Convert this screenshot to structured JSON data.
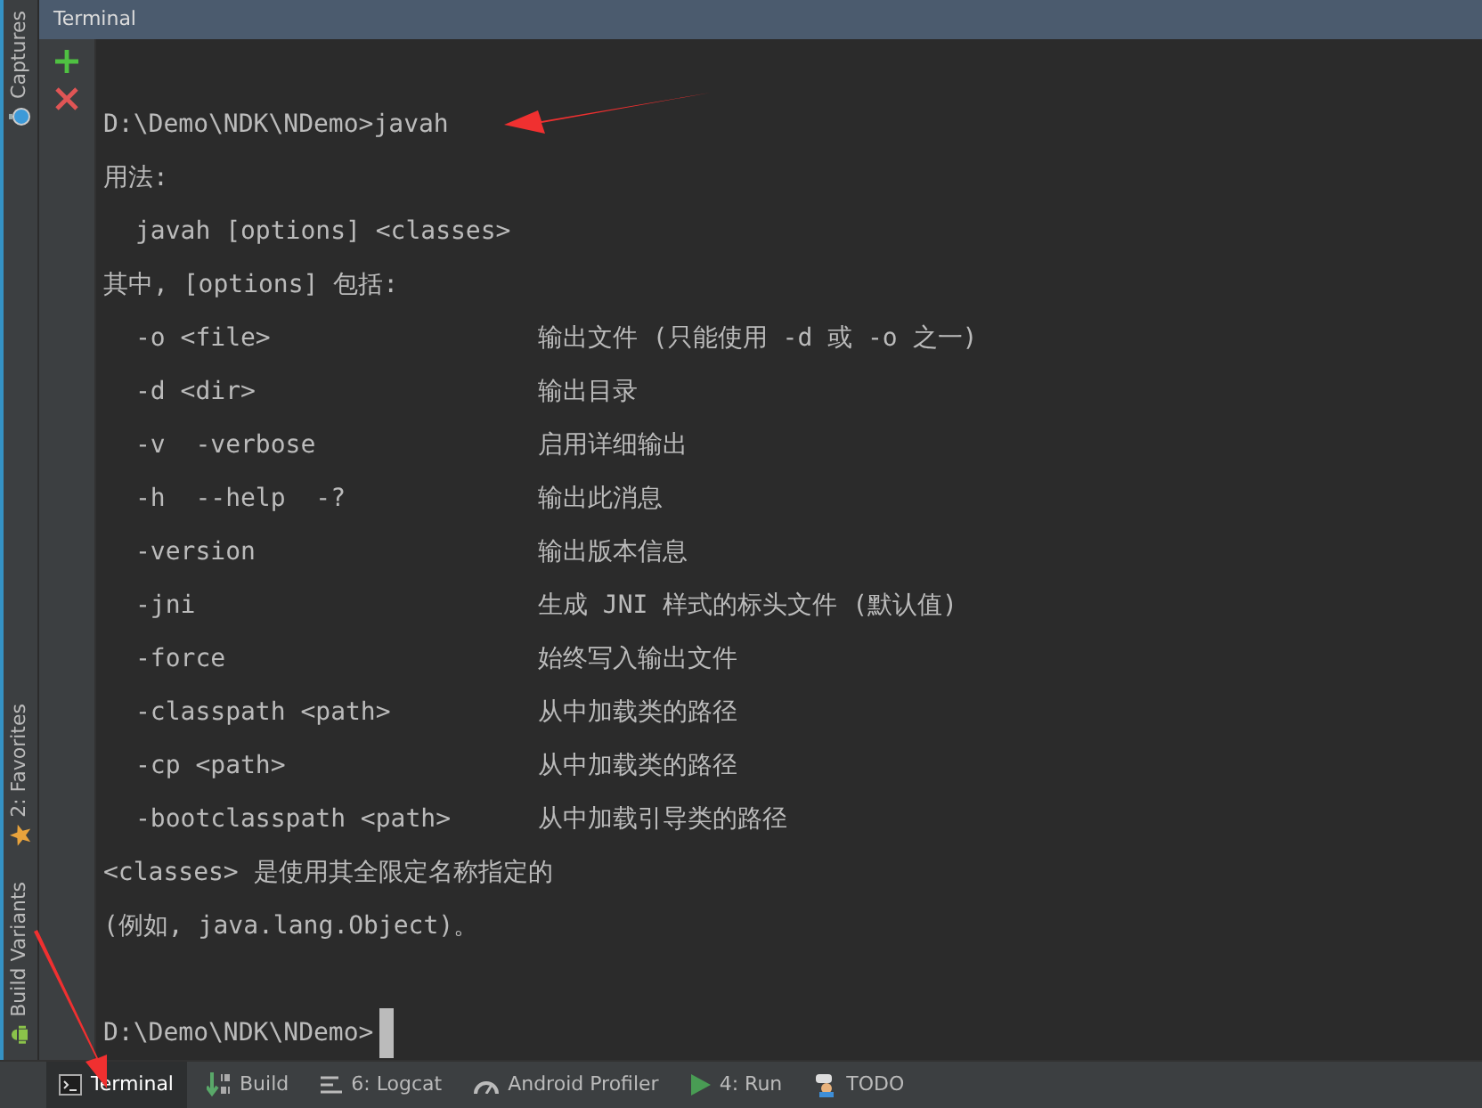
{
  "side_strip": {
    "top": [
      {
        "label": "Captures",
        "kind": "captures"
      }
    ],
    "bottom": [
      {
        "label": "2: Favorites",
        "kind": "favorites"
      },
      {
        "label": "Build Variants",
        "kind": "variants"
      }
    ]
  },
  "panel": {
    "title": "Terminal"
  },
  "terminal_lines": [
    {
      "kind": "prompt",
      "text": "D:\\Demo\\NDK\\NDemo>javah",
      "cursor": false
    },
    {
      "kind": "text",
      "text": "用法:",
      "indent": false
    },
    {
      "kind": "text",
      "text": "javah [options] <classes>",
      "indent": true
    },
    {
      "kind": "text",
      "text": "其中, [options] 包括:",
      "indent": false
    },
    {
      "kind": "option",
      "option": "-o <file>",
      "description": "输出文件 (只能使用 -d 或 -o 之一)"
    },
    {
      "kind": "option",
      "option": "-d <dir>",
      "description": "输出目录"
    },
    {
      "kind": "option",
      "option": "-v  -verbose",
      "description": "启用详细输出"
    },
    {
      "kind": "option",
      "option": "-h  --help  -?",
      "description": "输出此消息"
    },
    {
      "kind": "option",
      "option": "-version",
      "description": "输出版本信息"
    },
    {
      "kind": "option",
      "option": "-jni",
      "description": "生成 JNI 样式的标头文件 (默认值)"
    },
    {
      "kind": "option",
      "option": "-force",
      "description": "始终写入输出文件"
    },
    {
      "kind": "option",
      "option": "-classpath <path>",
      "description": "从中加载类的路径"
    },
    {
      "kind": "option",
      "option": "-cp <path>",
      "description": "从中加载类的路径"
    },
    {
      "kind": "option",
      "option": "-bootclasspath <path>",
      "description": "从中加载引导类的路径"
    },
    {
      "kind": "text",
      "text": "<classes> 是使用其全限定名称指定的",
      "indent": false
    },
    {
      "kind": "text",
      "text": "(例如, java.lang.Object)。",
      "indent": false
    },
    {
      "kind": "blank"
    },
    {
      "kind": "prompt",
      "text": "D:\\Demo\\NDK\\NDemo>",
      "cursor": true
    }
  ],
  "bottom_tabs": [
    {
      "label": "Terminal",
      "kind": "terminal",
      "selected": true
    },
    {
      "label": "Build",
      "kind": "build",
      "selected": false
    },
    {
      "label": "6: Logcat",
      "kind": "logcat",
      "selected": false
    },
    {
      "label": "Android Profiler",
      "kind": "profiler",
      "selected": false
    },
    {
      "label": "4: Run",
      "kind": "run",
      "selected": false
    },
    {
      "label": "TODO",
      "kind": "todo",
      "selected": false
    }
  ]
}
